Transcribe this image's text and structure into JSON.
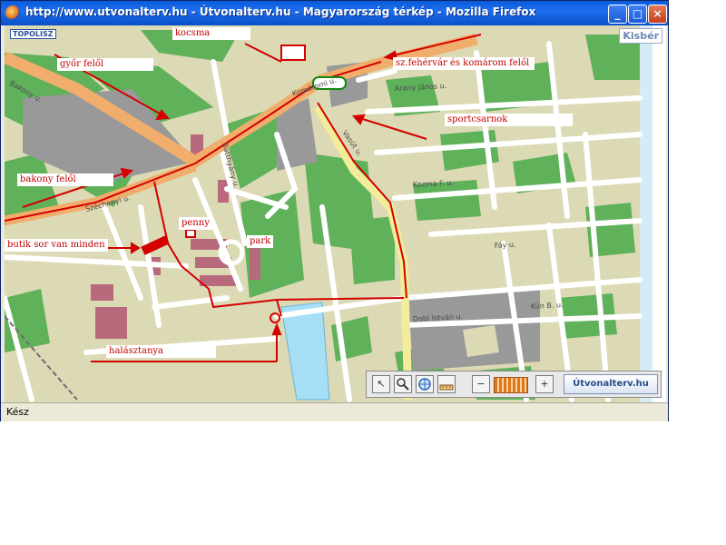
{
  "window": {
    "title": "http://www.utvonalterv.hu - Útvonalterv.hu - Magyarország térkép - Mozilla Firefox",
    "minimize_glyph": "_",
    "maximize_glyph": "□",
    "close_glyph": "×"
  },
  "status": {
    "text": "Kész"
  },
  "map": {
    "corner_badge": "Kisbér",
    "logo": "TOPOLISZ",
    "streets": [
      "Komáromi u.",
      "Vasút u.",
      "Széchenyi u.",
      "Kozma F. u.",
      "Bakony u.",
      "Arany János u.",
      "Batthyány u.",
      "Fáy u.",
      "Dobi István u.",
      "Kún B. u."
    ],
    "annotations": {
      "kocsma": "kocsma",
      "gyor": "győr felől",
      "szfehervar": "sz.fehérvár és komárom felől",
      "sportcsarnok": "sportcsarnok",
      "bakony": "bakony felől",
      "penny": "penny",
      "park": "park",
      "butik": "butik sor van minden",
      "halasztanya": "halásztanya"
    },
    "colors": {
      "background": "#dcd9b5",
      "green": "#5fb15a",
      "building": "#999999",
      "main_road": "#f0ad6b",
      "secondary_road": "#f3ec9a",
      "street": "#ffffff",
      "water": "#a6dff5",
      "annotation": "#d40000"
    }
  },
  "toolbar": {
    "pointer_icon": "↖",
    "zoom_out_glyph": "−",
    "zoom_in_glyph": "+",
    "brand": "Útvonalterv.hu"
  }
}
